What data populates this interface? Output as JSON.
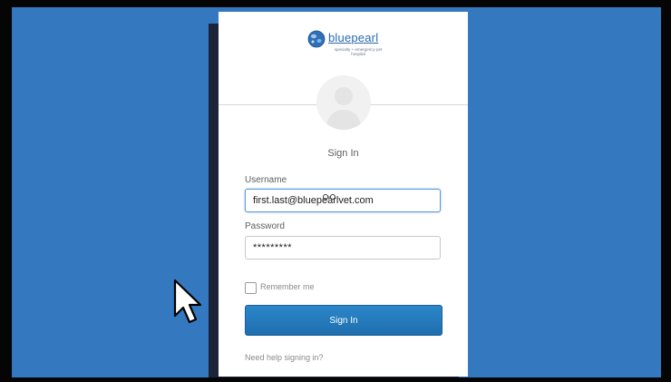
{
  "brand": {
    "name": "bluepearl",
    "tagline": "specialty + emergency pet hospital",
    "logo_icon": "paw-globe-icon",
    "color": "#2a6ab3"
  },
  "form": {
    "title": "Sign In",
    "username_label": "Username",
    "username_value": "first.last@bluepearlvet.com",
    "password_label": "Password",
    "password_value": "*********",
    "remember_label": "Remember me",
    "remember_checked": false,
    "submit_label": "Sign In",
    "help_link": "Need help signing in?"
  },
  "colors": {
    "background": "#3478c0",
    "button": "#2179bc",
    "focus_border": "#5b9bd8"
  }
}
